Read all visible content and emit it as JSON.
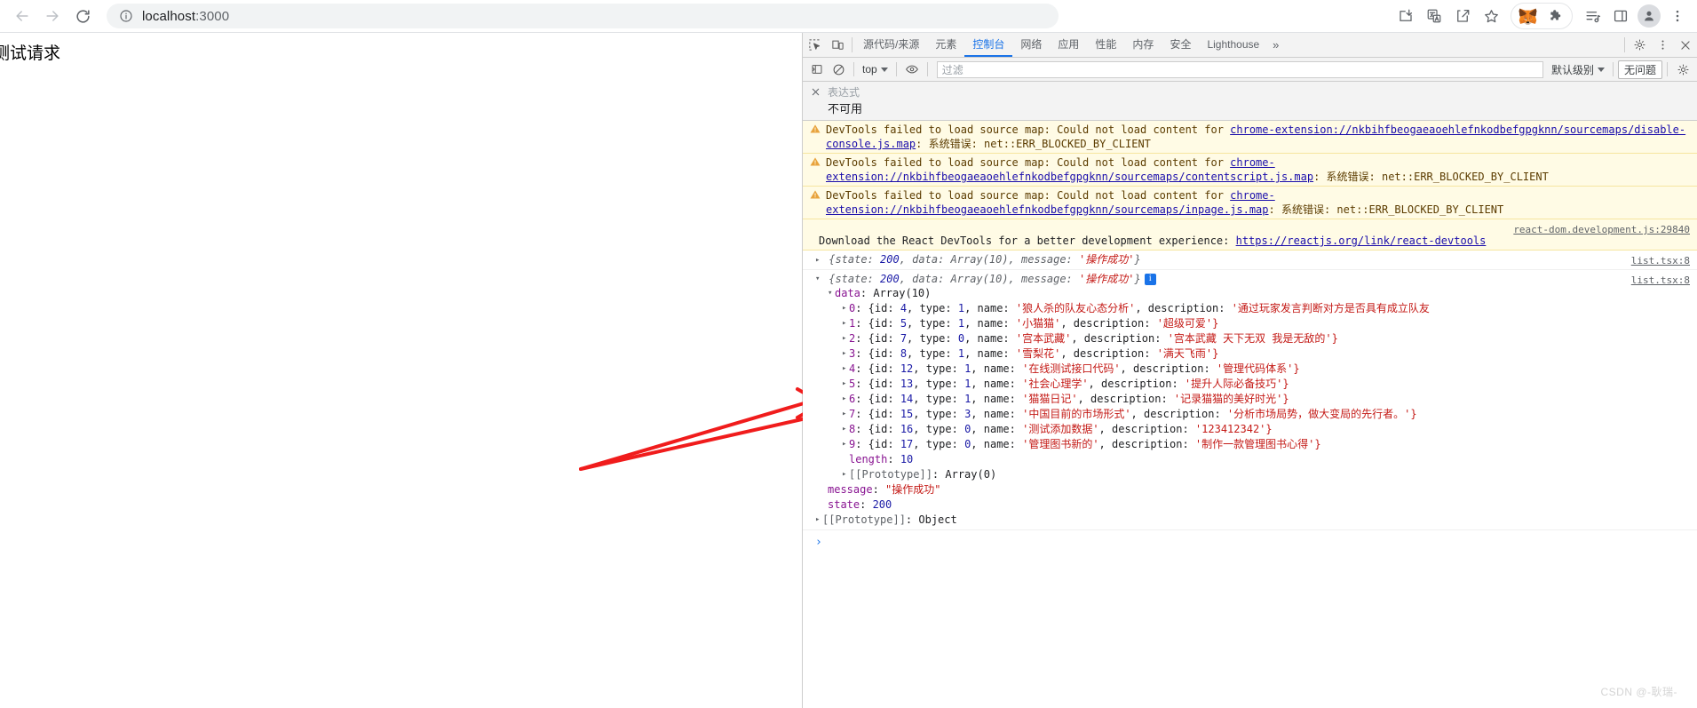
{
  "browser": {
    "back_icon": "arrow-left-icon",
    "forward_icon": "arrow-right-icon",
    "reload_icon": "reload-icon",
    "site_info_icon": "info-circle-icon",
    "url_host": "localhost",
    "url_rest": ":3000",
    "toolbar_icons": [
      {
        "name": "install-app-icon",
        "label": "安装"
      },
      {
        "name": "translate-icon",
        "label": "翻译"
      },
      {
        "name": "share-icon",
        "label": "分享"
      },
      {
        "name": "bookmark-star-icon",
        "label": "收藏"
      },
      {
        "name": "metamask-fox-icon",
        "label": "MetaMask"
      },
      {
        "name": "extensions-puzzle-icon",
        "label": "扩展程序"
      },
      {
        "name": "reading-list-icon",
        "label": "播放列表"
      },
      {
        "name": "side-panel-icon",
        "label": "侧边栏"
      },
      {
        "name": "profile-avatar-icon",
        "label": "个人资料"
      },
      {
        "name": "chrome-menu-icon",
        "label": "自定义及控制"
      }
    ]
  },
  "page": {
    "title": "测试请求"
  },
  "devtools": {
    "inspect_icon": "inspect-element-icon",
    "device_icon": "device-toolbar-icon",
    "tabs": [
      {
        "label": "源代码/来源",
        "active": false
      },
      {
        "label": "元素",
        "active": false
      },
      {
        "label": "控制台",
        "active": true
      },
      {
        "label": "网络",
        "active": false
      },
      {
        "label": "应用",
        "active": false
      },
      {
        "label": "性能",
        "active": false
      },
      {
        "label": "内存",
        "active": false
      },
      {
        "label": "安全",
        "active": false
      },
      {
        "label": "Lighthouse",
        "active": false
      }
    ],
    "more_tabs": "»",
    "settings_icon": "gear-icon",
    "kebab_icon": "more-vertical-icon",
    "close_icon": "close-icon",
    "filterbar": {
      "sidebar_icon": "console-sidebar-icon",
      "clear_icon": "clear-console-icon",
      "context": "top",
      "eye_icon": "live-expression-eye-icon",
      "filter_placeholder": "过滤",
      "filter_value": "",
      "levels": "默认级别",
      "issues_badge": "无问题",
      "settings_icon": "console-settings-gear-icon"
    },
    "expression": {
      "close_icon": "close-icon",
      "placeholder": "表达式",
      "value": "不可用"
    },
    "messages": [
      {
        "kind": "warning",
        "icon": "warning-triangle-icon",
        "pre": "DevTools failed to load source map: Could not load content for ",
        "link": "chrome-extension://nkbihfbeogaeaoehlefnkodbefgpgknn/sourcemaps/disable-console.js.map",
        "post": ": 系统错误: net::ERR_BLOCKED_BY_CLIENT"
      },
      {
        "kind": "warning",
        "icon": "warning-triangle-icon",
        "pre": "DevTools failed to load source map: Could not load content for ",
        "link": "chrome-extension://nkbihfbeogaeaoehlefnkodbefgpgknn/sourcemaps/contentscript.js.map",
        "post": ": 系统错误: net::ERR_BLOCKED_BY_CLIENT"
      },
      {
        "kind": "warning",
        "icon": "warning-triangle-icon",
        "pre": "DevTools failed to load source map: Could not load content for ",
        "link": "chrome-extension://nkbihfbeogaeaoehlefnkodbefgpgknn/sourcemaps/inpage.js.map",
        "post": ": 系统错误: net::ERR_BLOCKED_BY_CLIENT"
      }
    ],
    "react_message": {
      "source": "react-dom.development.js:29840",
      "text": "Download the React DevTools for a better development experience: ",
      "link": "https://reactjs.org/link/react-devtools"
    },
    "log_collapsed": {
      "triangle": "▸",
      "summary_prefix": "{state: ",
      "state": "200",
      "mid": ", data: Array(10), message: ",
      "message": "'操作成功'",
      "suffix": "}",
      "source": "list.tsx:8"
    },
    "log_expanded": {
      "triangle": "▾",
      "summary_prefix": "{state: ",
      "state": "200",
      "mid": ", data: Array(10), message: ",
      "message": "'操作成功'",
      "suffix": "}",
      "info_badge": "i",
      "source": "list.tsx:8",
      "data_label": "data",
      "data_value": "Array(10)",
      "items": [
        {
          "index": "0",
          "id": "4",
          "type": "1",
          "name": "'狼人杀的队友心态分析'",
          "description": "'通过玩家发言判断对方是否具有成立队友"
        },
        {
          "index": "1",
          "id": "5",
          "type": "1",
          "name": "'小猫猫'",
          "description": "'超级可爱'}"
        },
        {
          "index": "2",
          "id": "7",
          "type": "0",
          "name": "'宫本武藏'",
          "description": "'宫本武藏 天下无双 我是无敌的'}"
        },
        {
          "index": "3",
          "id": "8",
          "type": "1",
          "name": "'雪梨花'",
          "description": "'满天飞雨'}"
        },
        {
          "index": "4",
          "id": "12",
          "type": "1",
          "name": "'在线测试接口代码'",
          "description": "'管理代码体系'}"
        },
        {
          "index": "5",
          "id": "13",
          "type": "1",
          "name": "'社会心理学'",
          "description": "'提升人际必备技巧'}"
        },
        {
          "index": "6",
          "id": "14",
          "type": "1",
          "name": "'猫猫日记'",
          "description": "'记录猫猫的美好时光'}"
        },
        {
          "index": "7",
          "id": "15",
          "type": "3",
          "name": "'中国目前的市场形式'",
          "description": "'分析市场局势，做大变局的先行者。'}"
        },
        {
          "index": "8",
          "id": "16",
          "type": "0",
          "name": "'测试添加数据'",
          "description": "'123412342'}"
        },
        {
          "index": "9",
          "id": "17",
          "type": "0",
          "name": "'管理图书新的'",
          "description": "'制作一款管理图书心得'}"
        }
      ],
      "length_label": "length",
      "length_value": "10",
      "array_proto": "[[Prototype]]",
      "array_proto_value": "Array(0)",
      "message_label": "message",
      "message_value": "\"操作成功\"",
      "state_label": "state",
      "state_value": "200",
      "object_proto": "[[Prototype]]",
      "object_proto_value": "Object"
    },
    "prompt": "›"
  },
  "annotation": {
    "arrow_color": "#f01c1c"
  },
  "watermark": "CSDN @-耿瑞-"
}
